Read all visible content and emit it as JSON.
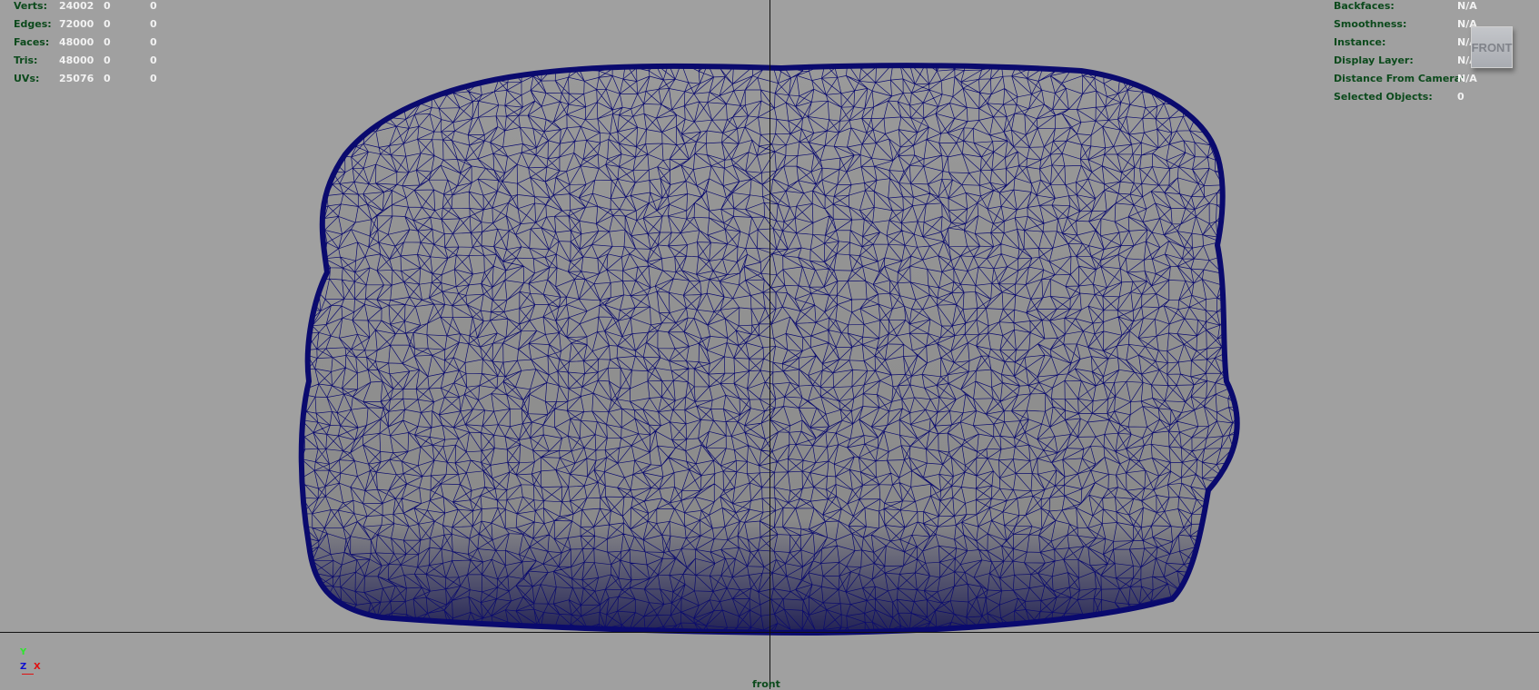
{
  "poly_stats": [
    {
      "label": "Verts:",
      "values": [
        "24002",
        "0",
        "0"
      ]
    },
    {
      "label": "Edges:",
      "values": [
        "72000",
        "0",
        "0"
      ]
    },
    {
      "label": "Faces:",
      "values": [
        "48000",
        "0",
        "0"
      ]
    },
    {
      "label": "Tris:",
      "values": [
        "48000",
        "0",
        "0"
      ]
    },
    {
      "label": "UVs:",
      "values": [
        "25076",
        "0",
        "0"
      ]
    }
  ],
  "object_info": [
    {
      "label": "Backfaces:",
      "value": "N/A"
    },
    {
      "label": "Smoothness:",
      "value": "N/A"
    },
    {
      "label": "Instance:",
      "value": "N/A"
    },
    {
      "label": "Display Layer:",
      "value": "N/A"
    },
    {
      "label": "Distance From Camera:",
      "value": "N/A"
    },
    {
      "label": "Selected Objects:",
      "value": "0"
    }
  ],
  "view_cube": {
    "label": "FRONT"
  },
  "camera_name": "front",
  "axis": {
    "y": "Y",
    "z": "Z",
    "x": "X"
  },
  "colors": {
    "background": "#a0a0a0",
    "wire": "#0a0a6e",
    "surface": "#8c8c8c"
  }
}
